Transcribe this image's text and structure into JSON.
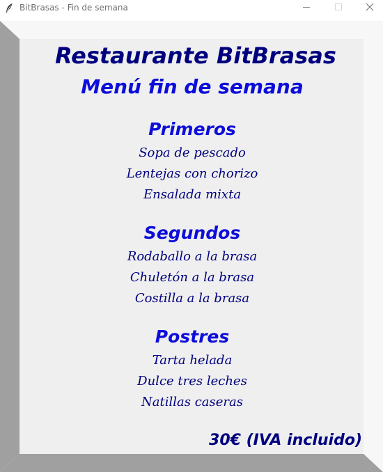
{
  "window": {
    "title": "BitBrasas - Fin de semana",
    "icons": {
      "app": "feather-icon",
      "minimize": "minimize-icon",
      "maximize": "maximize-icon",
      "close": "close-icon"
    }
  },
  "menu": {
    "restaurant_name": "Restaurante BitBrasas",
    "subtitle": "Menú fin de semana",
    "courses": [
      {
        "heading": "Primeros",
        "dishes": [
          "Sopa de pescado",
          "Lentejas con chorizo",
          "Ensalada mixta"
        ]
      },
      {
        "heading": "Segundos",
        "dishes": [
          "Rodaballo a la brasa",
          "Chuletón a la brasa",
          "Costilla a la brasa"
        ]
      },
      {
        "heading": "Postres",
        "dishes": [
          "Tarta helada",
          "Dulce tres leches",
          "Natillas caseras"
        ]
      }
    ],
    "price": "30€ (IVA incluido)"
  },
  "colors": {
    "title_text": "#00007f",
    "heading_text": "#0d0ddb",
    "panel_background": "#efefef",
    "frame_light": "#f7f7f7",
    "frame_dark": "#a0a0a0"
  }
}
